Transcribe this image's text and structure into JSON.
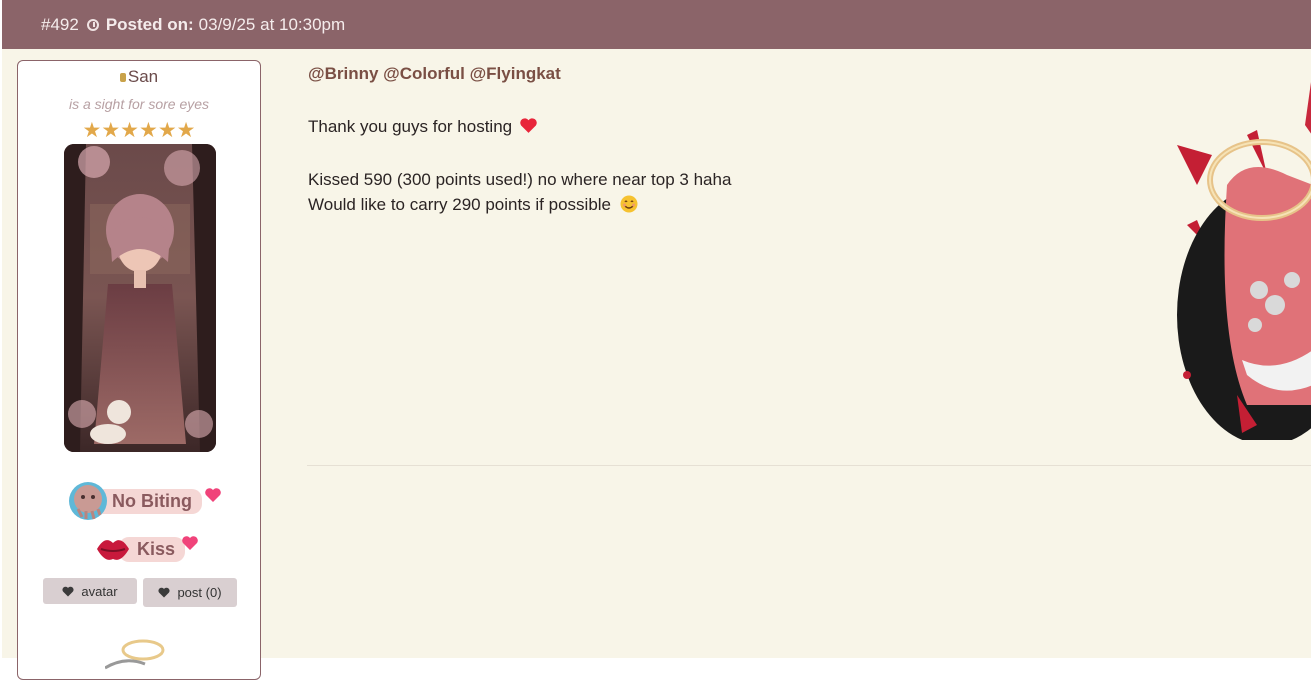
{
  "post": {
    "number": "#492",
    "posted_label": "Posted on:",
    "posted_date": "03/9/25 at 10:30pm"
  },
  "user": {
    "name": "San",
    "title": "is a sight for sore eyes",
    "stars": "★★★★★★",
    "badges": [
      {
        "label": "No Biting"
      },
      {
        "label": "Kiss"
      }
    ],
    "buttons": {
      "avatar": "avatar",
      "post": "post (0)"
    }
  },
  "message": {
    "mentions": "@Brinny @Colorful @Flyingkat",
    "line1": "Thank you guys for hosting",
    "line2": "Kissed 590 (300 points used!) no where near top 3 haha",
    "line3": "Would like to carry 290 points if possible"
  },
  "colors": {
    "header": "#8b6469",
    "background": "#f8f5e8",
    "star": "#e2a84a",
    "badge_bg": "#f5d7d5"
  }
}
